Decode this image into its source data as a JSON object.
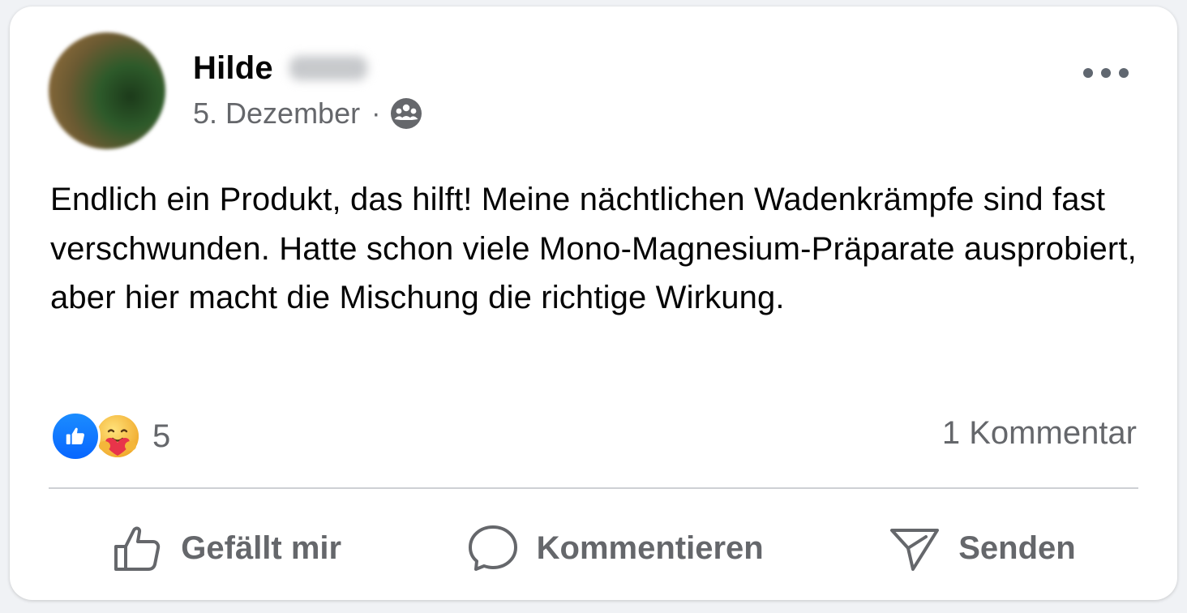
{
  "post": {
    "author_first_name": "Hilde",
    "date": "5. Dezember",
    "separator": "·",
    "audience_icon": "group-icon",
    "text": "Endlich ein Produkt, das hilft! Meine nächtlichen Wadenkrämpfe sind fast verschwunden. Hatte schon viele Mono-Magnesium-Präparate ausprobiert, aber hier macht die Mischung die richtige Wirkung."
  },
  "reactions": {
    "icons": [
      "like-icon",
      "care-icon"
    ],
    "count": "5"
  },
  "comments": {
    "count_label": "1 Kommentar"
  },
  "actions": {
    "like_label": "Gefällt mir",
    "comment_label": "Kommentieren",
    "send_label": "Senden"
  },
  "colors": {
    "brand_blue": "#0866ff",
    "secondary_text": "#65676b",
    "primary_text": "#050505",
    "divider": "#ced0d4"
  }
}
